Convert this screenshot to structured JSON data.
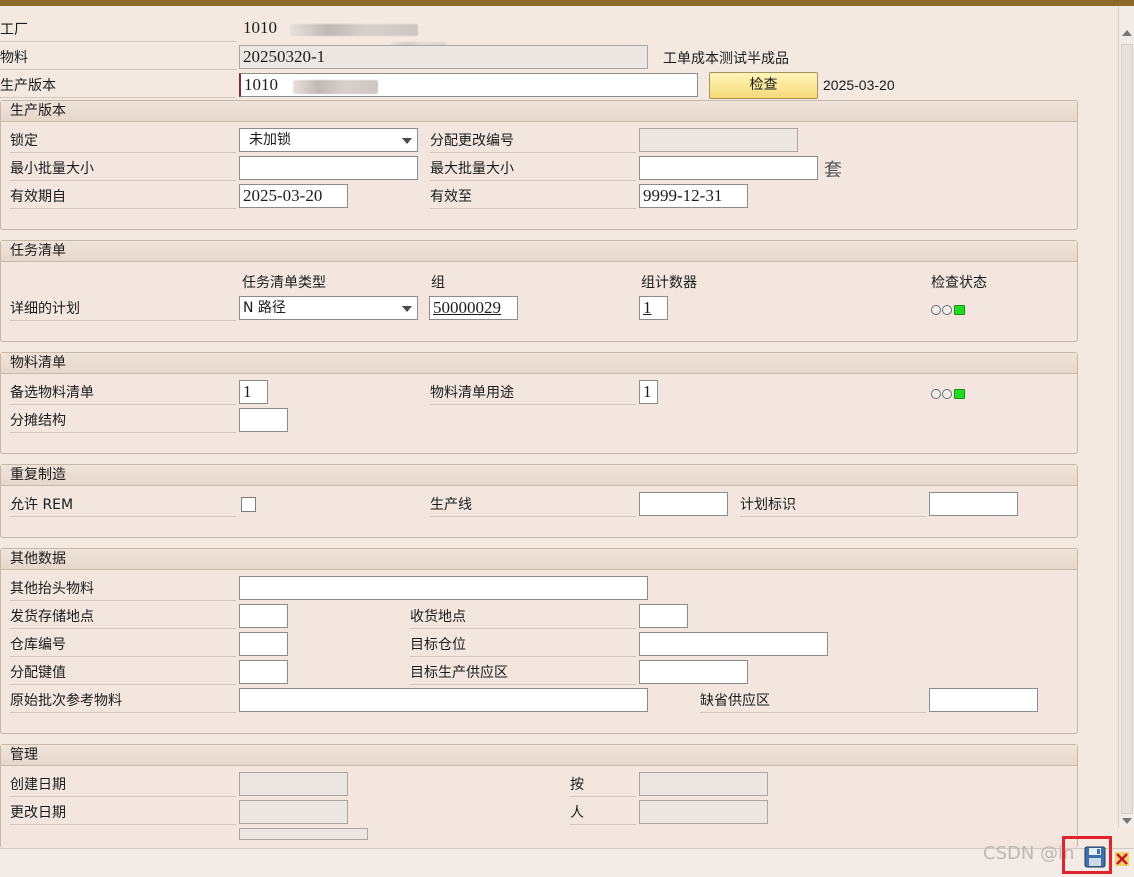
{
  "header": {
    "plant_label": "工厂",
    "plant_value": "1010",
    "material_label": "物料",
    "material_value": "20250320-1",
    "material_desc": "工单成本测试半成品",
    "version_label": "生产版本",
    "version_value": "1010",
    "check_button": "检查",
    "check_date": "2025-03-20"
  },
  "prod_version": {
    "title": "生产版本",
    "lock_label": "锁定",
    "lock_value": "未加锁",
    "change_no_label": "分配更改编号",
    "min_lot_label": "最小批量大小",
    "max_lot_label": "最大批量大小",
    "unit": "套",
    "valid_from_label": "有效期自",
    "valid_from_value": "2025-03-20",
    "valid_to_label": "有效至",
    "valid_to_value": "9999-12-31"
  },
  "task_list": {
    "title": "任务清单",
    "col_type": "任务清单类型",
    "col_group": "组",
    "col_counter": "组计数器",
    "col_status": "检查状态",
    "row_label": "详细的计划",
    "type_value": "N 路径",
    "group_value": "50000029",
    "counter_value": "1",
    "status": "green"
  },
  "bom": {
    "title": "物料清单",
    "alt_bom_label": "备选物料清单",
    "alt_bom_value": "1",
    "usage_label": "物料清单用途",
    "usage_value": "1",
    "apportion_label": "分摊结构",
    "status": "green"
  },
  "rem": {
    "title": "重复制造",
    "allow_label": "允许 REM",
    "allow_checked": false,
    "line_label": "生产线",
    "plan_id_label": "计划标识"
  },
  "other": {
    "title": "其他数据",
    "other_header_label": "其他抬头物料",
    "issue_loc_label": "发货存储地点",
    "receive_loc_label": "收货地点",
    "warehouse_label": "仓库编号",
    "target_bin_label": "目标仓位",
    "dist_key_label": "分配键值",
    "target_supply_label": "目标生产供应区",
    "orig_batch_label": "原始批次参考物料",
    "default_supply_label": "缺省供应区"
  },
  "admin": {
    "title": "管理",
    "created_label": "创建日期",
    "by_label": "按",
    "changed_label": "更改日期",
    "person_label": "人"
  },
  "footer": {
    "watermark": "CSDN @in",
    "save_icon": "save-icon",
    "highlight_color": "#e0242f"
  }
}
